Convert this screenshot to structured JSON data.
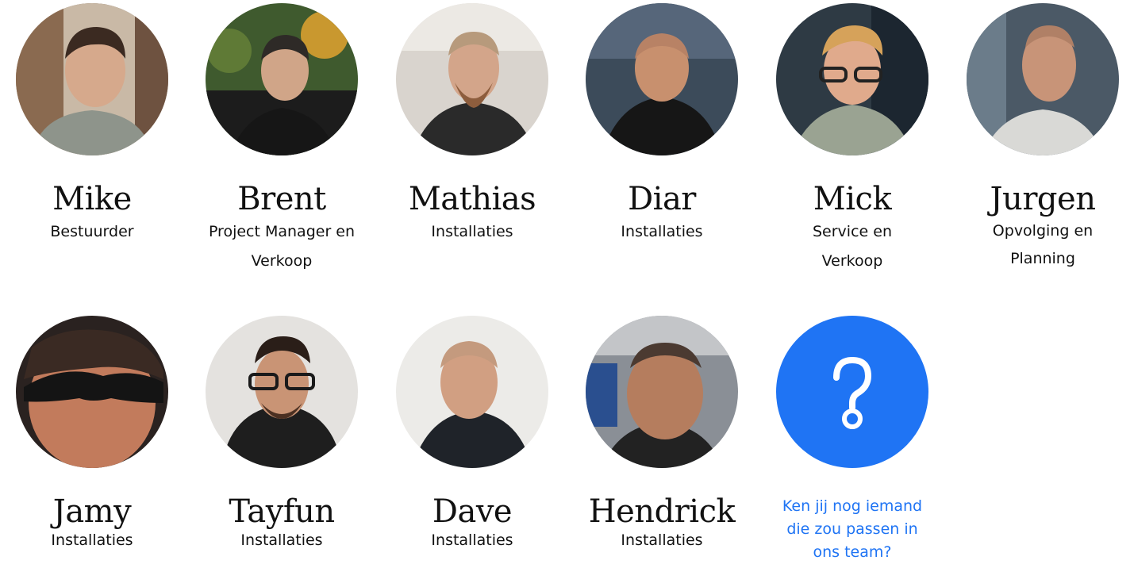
{
  "team": {
    "members": [
      {
        "name": "Mike",
        "role": "Bestuurder"
      },
      {
        "name": "Brent",
        "role": "Project Manager en Verkoop"
      },
      {
        "name": "Mathias",
        "role": "Installaties"
      },
      {
        "name": "Diar",
        "role": "Installaties"
      },
      {
        "name": "Mick",
        "role": "Service en Verkoop"
      },
      {
        "name": "Jurgen",
        "role": "Opvolging en Planning"
      },
      {
        "name": "Jamy",
        "role": "Installaties"
      },
      {
        "name": "Tayfun",
        "role": "Installaties"
      },
      {
        "name": "Dave",
        "role": "Installaties"
      },
      {
        "name": "Hendrick",
        "role": "Installaties"
      }
    ],
    "invite": {
      "text": "Ken jij nog iemand die zou passen in ons team?",
      "icon": "question-mark-icon",
      "color": "#1f74f4"
    }
  }
}
